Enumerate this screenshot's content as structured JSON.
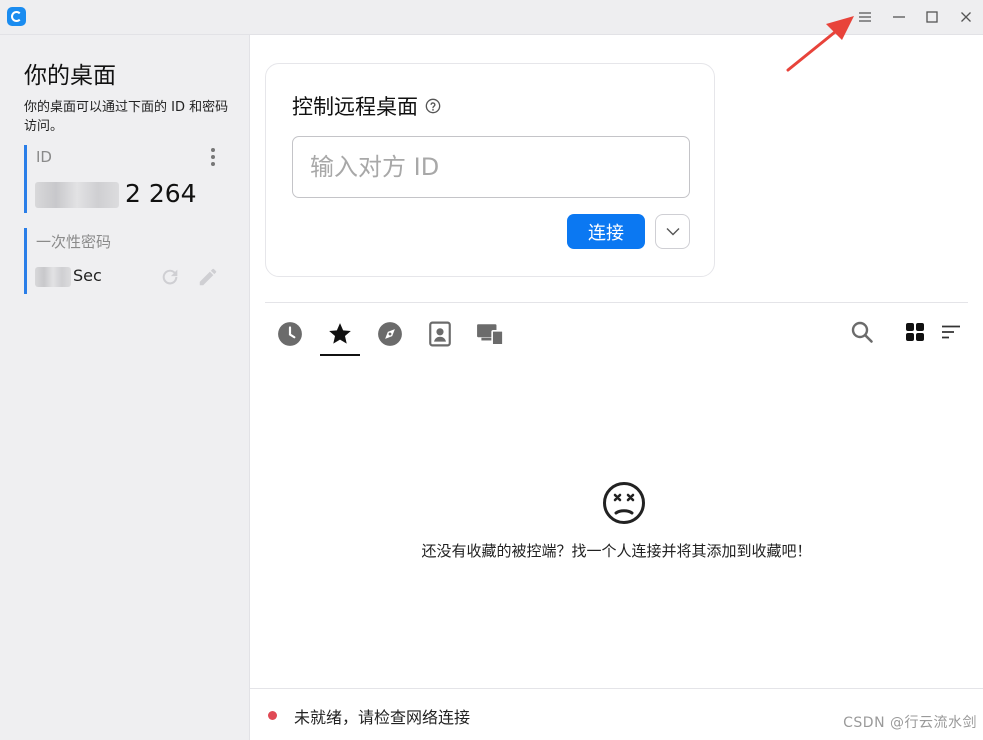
{
  "sidebar": {
    "title": "你的桌面",
    "description": "你的桌面可以通过下面的 ID 和密码访问。",
    "id_card": {
      "label": "ID",
      "value_visible": "2 264"
    },
    "password_card": {
      "label": "一次性密码",
      "value_visible": "Sec"
    }
  },
  "connect": {
    "title": "控制远程桌面",
    "input_placeholder": "输入对方 ID",
    "connect_label": "连接"
  },
  "tabs": [
    {
      "icon": "history-icon"
    },
    {
      "icon": "star-icon",
      "active": true
    },
    {
      "icon": "compass-icon"
    },
    {
      "icon": "address-book-icon"
    },
    {
      "icon": "devices-icon"
    }
  ],
  "empty_state": {
    "message": "还没有收藏的被控端？找一个人连接并将其添加到收藏吧！"
  },
  "status": {
    "text": "未就绪，请检查网络连接",
    "color": "#e04a55"
  },
  "watermark": "CSDN @行云流水剑",
  "colors": {
    "accent": "#0b78f2",
    "sidebar_bar": "#2a7ee8",
    "annotation": "#e8433a"
  }
}
